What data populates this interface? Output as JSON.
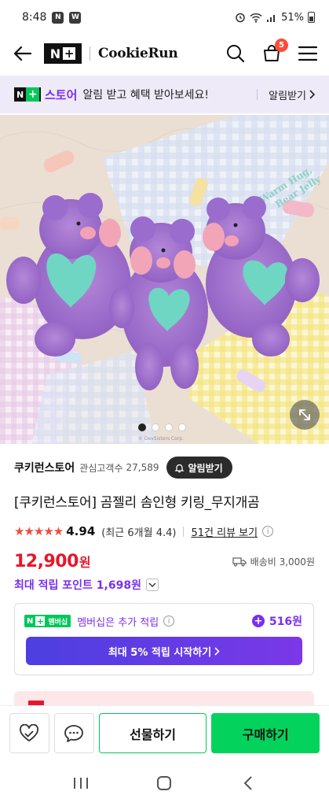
{
  "status_bar": {
    "time": "8:48",
    "app_icon_1": "N",
    "app_icon_2": "W",
    "battery": "51%"
  },
  "header": {
    "logo_n": "N",
    "logo_plus": "+",
    "brand": "CookieRun",
    "cart_count": "5"
  },
  "banner": {
    "logo_n": "N",
    "logo_plus": "+",
    "store_word": "스토어",
    "text": "알림 받고 혜택 받아보세요!",
    "link": "알림받기"
  },
  "product_image": {
    "sign_text_1": "Warm Hug,",
    "sign_text_2": "Bear Jelly",
    "copyright": "© DevSisters Corp.",
    "dot_count": 4,
    "active_dot": 0
  },
  "store": {
    "name": "쿠키런스토어",
    "follower_label": "관심고객수",
    "follower_count": "27,589",
    "alarm_button": "알림받기"
  },
  "product": {
    "title": "[쿠키런스토어] 곰젤리 솜인형 키링_무지개곰",
    "stars": "★★★★★",
    "rating": "4.94",
    "recent_rating": "(최근 6개월 4.4)",
    "review_link": "51건 리뷰 보기",
    "price": "12,900",
    "price_unit": "원",
    "shipping": "배송비 3,000원",
    "points": "최대 적립 포인트 1,698원"
  },
  "membership": {
    "badge_n": "N",
    "badge_plus": "+",
    "badge_text": "멤버십",
    "text": "멤버십은 추가 적립",
    "extra_points": "516원",
    "cta": "최대 5% 적립 시작하기"
  },
  "action_bar": {
    "gift_button": "선물하기",
    "buy_button": "구매하기"
  },
  "colors": {
    "brand_purple": "#7b2ff0",
    "naver_green": "#03c75a",
    "price_red": "#e5172c"
  }
}
